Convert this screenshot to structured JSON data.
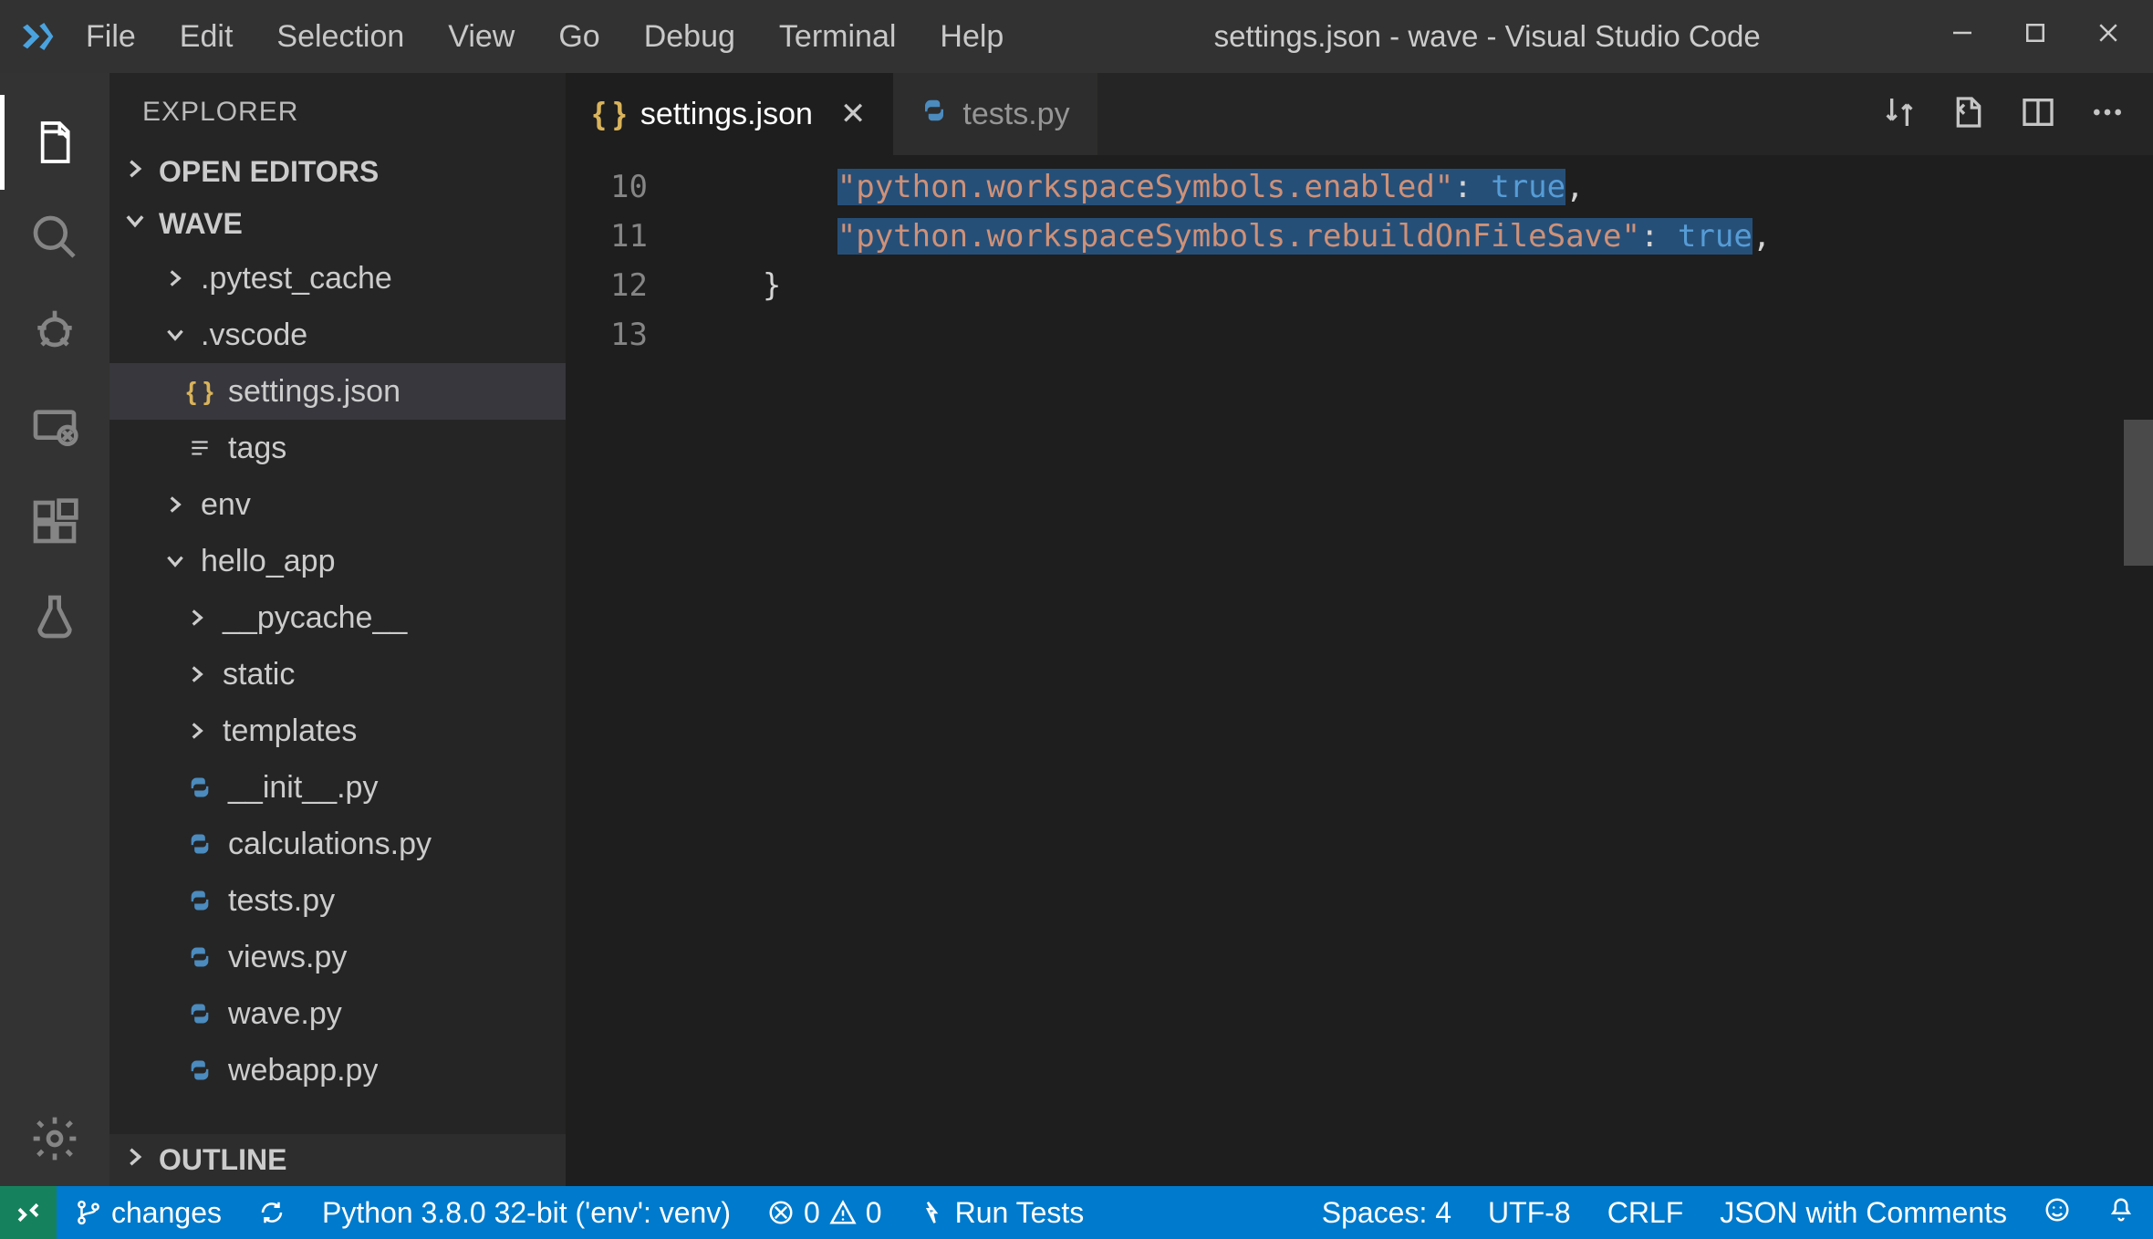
{
  "titlebar": {
    "menu": [
      "File",
      "Edit",
      "Selection",
      "View",
      "Go",
      "Debug",
      "Terminal",
      "Help"
    ],
    "title": "settings.json - wave - Visual Studio Code"
  },
  "sidebar": {
    "title": "EXPLORER",
    "sections": {
      "open_editors": "OPEN EDITORS",
      "workspace": "WAVE",
      "outline": "OUTLINE"
    },
    "tree": [
      {
        "label": ".pytest_cache",
        "type": "folder",
        "expanded": false,
        "indent": 1
      },
      {
        "label": ".vscode",
        "type": "folder",
        "expanded": true,
        "indent": 1
      },
      {
        "label": "settings.json",
        "type": "json",
        "indent": 2,
        "selected": true
      },
      {
        "label": "tags",
        "type": "file",
        "indent": 2
      },
      {
        "label": "env",
        "type": "folder",
        "expanded": false,
        "indent": 1
      },
      {
        "label": "hello_app",
        "type": "folder",
        "expanded": true,
        "indent": 1
      },
      {
        "label": "__pycache__",
        "type": "folder",
        "expanded": false,
        "indent": 2
      },
      {
        "label": "static",
        "type": "folder",
        "expanded": false,
        "indent": 2
      },
      {
        "label": "templates",
        "type": "folder",
        "expanded": false,
        "indent": 2
      },
      {
        "label": "__init__.py",
        "type": "py",
        "indent": 2
      },
      {
        "label": "calculations.py",
        "type": "py",
        "indent": 2
      },
      {
        "label": "tests.py",
        "type": "py",
        "indent": 2
      },
      {
        "label": "views.py",
        "type": "py",
        "indent": 2
      },
      {
        "label": "wave.py",
        "type": "py",
        "indent": 2
      },
      {
        "label": "webapp.py",
        "type": "py",
        "indent": 2,
        "cutoff": true
      }
    ]
  },
  "tabs": [
    {
      "label": "settings.json",
      "icon": "json",
      "active": true,
      "closeable": true
    },
    {
      "label": "tests.py",
      "icon": "py",
      "active": false,
      "closeable": false
    }
  ],
  "editor": {
    "line_start": 10,
    "lines": [
      {
        "n": 10,
        "indent": "        ",
        "key": "python.workspaceSymbols.enabled",
        "value": "true",
        "trailing": ","
      },
      {
        "n": 11,
        "indent": "        ",
        "key": "python.workspaceSymbols.rebuildOnFileSave",
        "value": "true",
        "trailing": ","
      },
      {
        "n": 12,
        "raw": "    }"
      },
      {
        "n": 13,
        "raw": ""
      }
    ]
  },
  "statusbar": {
    "branch": "changes",
    "python": "Python 3.8.0 32-bit ('env': venv)",
    "errors": "0",
    "warnings": "0",
    "runtests": "Run Tests",
    "spaces": "Spaces: 4",
    "encoding": "UTF-8",
    "eol": "CRLF",
    "language": "JSON with Comments"
  }
}
